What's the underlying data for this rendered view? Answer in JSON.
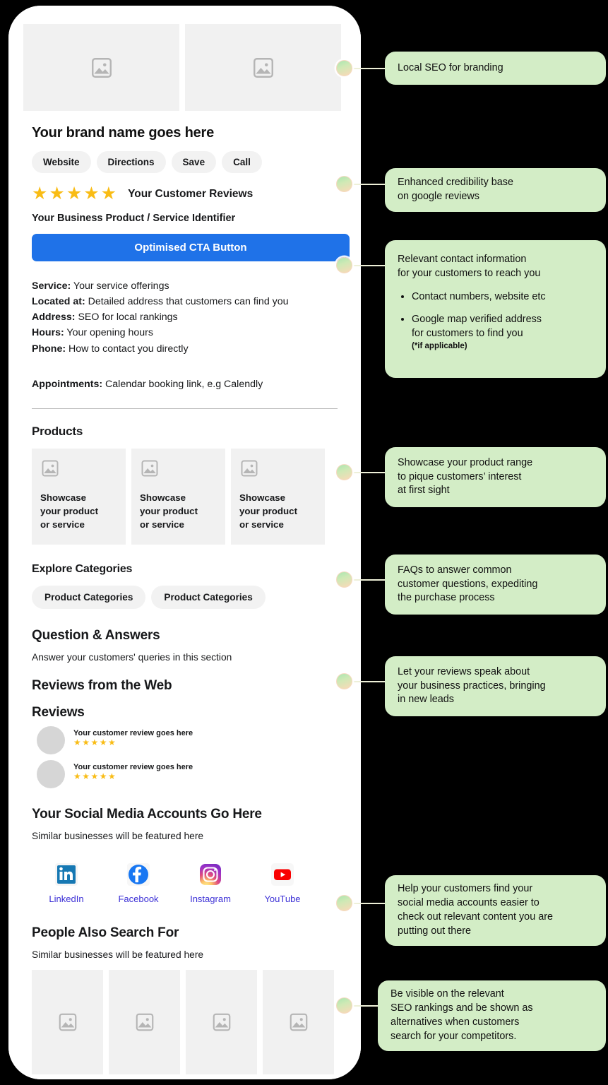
{
  "phone": {
    "brand_name": "Your brand name goes here",
    "action_buttons": [
      "Website",
      "Directions",
      "Save",
      "Call"
    ],
    "rating": {
      "stars": 5,
      "stars_glyphs": "★★★★★",
      "label": "Your Customer Reviews"
    },
    "identifier": "Your Business Product / Service Identifier",
    "cta_label": "Optimised CTA Button",
    "contact": {
      "lines": [
        {
          "label": "Service:",
          "value": " Your service offerings"
        },
        {
          "label": "Located at:",
          "value": " Detailed address that customers can find you"
        },
        {
          "label": "Address:",
          "value": " SEO for local rankings"
        },
        {
          "label": "Hours:",
          "value": " Your opening hours"
        },
        {
          "label": "Phone:",
          "value": " How to contact you directly"
        }
      ],
      "appointments_label": "Appointments:",
      "appointments_value": " Calendar booking link, e.g Calendly"
    },
    "products_heading": "Products",
    "products": [
      "Showcase\nyour product\nor service",
      "Showcase\nyour product\nor service",
      "Showcase\nyour product\nor service"
    ],
    "explore_heading": "Explore Categories",
    "categories": [
      "Product Categories",
      "Product Categories"
    ],
    "qa_heading": "Question & Answers",
    "qa_body": "Answer your customers' queries in this section",
    "reviews_web_heading": "Reviews from the Web",
    "reviews_heading": "Reviews",
    "reviews": [
      {
        "text": "Your customer review goes here",
        "stars": "★★★★★"
      },
      {
        "text": "Your customer review goes here",
        "stars": "★★★★★"
      }
    ],
    "social_heading": "Your Social Media Accounts Go Here",
    "social_body": "Similar businesses will be featured here",
    "socials": [
      {
        "name": "LinkedIn",
        "icon": "linkedin-icon"
      },
      {
        "name": "Facebook",
        "icon": "facebook-icon"
      },
      {
        "name": "Instagram",
        "icon": "instagram-icon"
      },
      {
        "name": "YouTube",
        "icon": "youtube-icon"
      }
    ],
    "pasf_heading": "People Also Search For",
    "pasf_body": "Similar businesses will be featured here"
  },
  "callouts": {
    "c1": "Local SEO for branding",
    "c2": "Enhanced credibility base\non google reviews",
    "c3_title": "Relevant contact information\nfor your customers to reach you",
    "c3_b1": "Contact numbers, website etc",
    "c3_b2": "Google map verified address\nfor customers to find you",
    "c3_b2_sub": "(*if applicable)",
    "c4": "Showcase your product range\nto pique customers’ interest\nat first sight",
    "c5": "FAQs to answer common\ncustomer questions, expediting\nthe purchase process",
    "c6": "Let your reviews speak about\nyour business practices, bringing\nin new leads",
    "c7": "Help your customers find your\nsocial media accounts easier to\ncheck out relevant content you are\nputting out there",
    "c8": "Be visible on the relevant\nSEO rankings and be shown as\nalternatives when customers\nsearch for your competitors."
  },
  "colors": {
    "background": "#000000",
    "phone": "#ffffff",
    "callout": "#d3edc6",
    "cta": "#1f72e8",
    "star": "#f9bc15",
    "placeholder": "#f1f1f1",
    "social_label": "#3b2fd6"
  }
}
